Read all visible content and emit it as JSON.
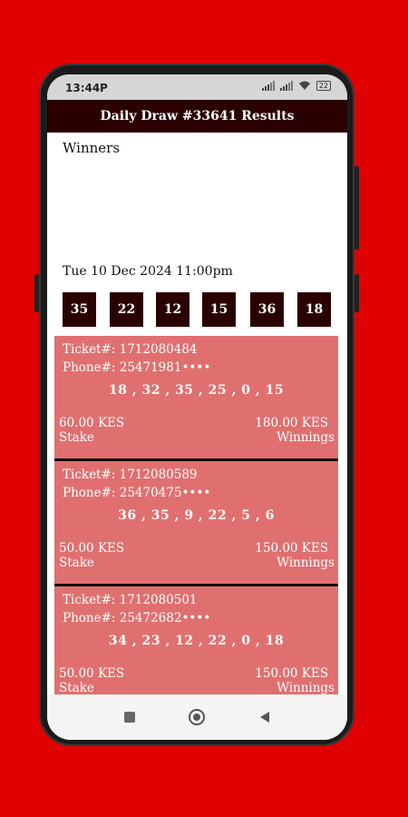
{
  "status": {
    "time": "13:44",
    "indicator": "P",
    "battery": "22"
  },
  "appbar": {
    "title": "Daily Draw #33641 Results"
  },
  "winners_label": "Winners",
  "draw_datetime": "Tue 10 Dec 2024  11:00pm",
  "balls": [
    "35",
    "22",
    "12",
    "15",
    "36",
    "18"
  ],
  "tickets": [
    {
      "ticket": "Ticket#: 1712080484",
      "phone": "Phone#: 25471981••••",
      "numbers": "18 , 32 , 35 , 25 , 0 , 15",
      "stake_value": "60.00 KES",
      "stake_label": "Stake",
      "win_value": "180.00 KES",
      "win_label": "Winnings"
    },
    {
      "ticket": "Ticket#: 1712080589",
      "phone": "Phone#: 25470475••••",
      "numbers": "36 , 35 , 9 , 22 , 5 , 6",
      "stake_value": "50.00 KES",
      "stake_label": "Stake",
      "win_value": "150.00 KES",
      "win_label": "Winnings"
    },
    {
      "ticket": "Ticket#: 1712080501",
      "phone": "Phone#: 25472682••••",
      "numbers": "34 , 23 , 12 , 22 , 0 , 18",
      "stake_value": "50.00 KES",
      "stake_label": "Stake",
      "win_value": "150.00 KES",
      "win_label": "Winnings"
    }
  ],
  "colors": {
    "background": "#e00000",
    "appbar": "#2a0000",
    "ticket": "#e07070"
  },
  "icons": {
    "nav_recents": "square-icon",
    "nav_home": "circle-icon",
    "nav_back": "triangle-back-icon"
  }
}
